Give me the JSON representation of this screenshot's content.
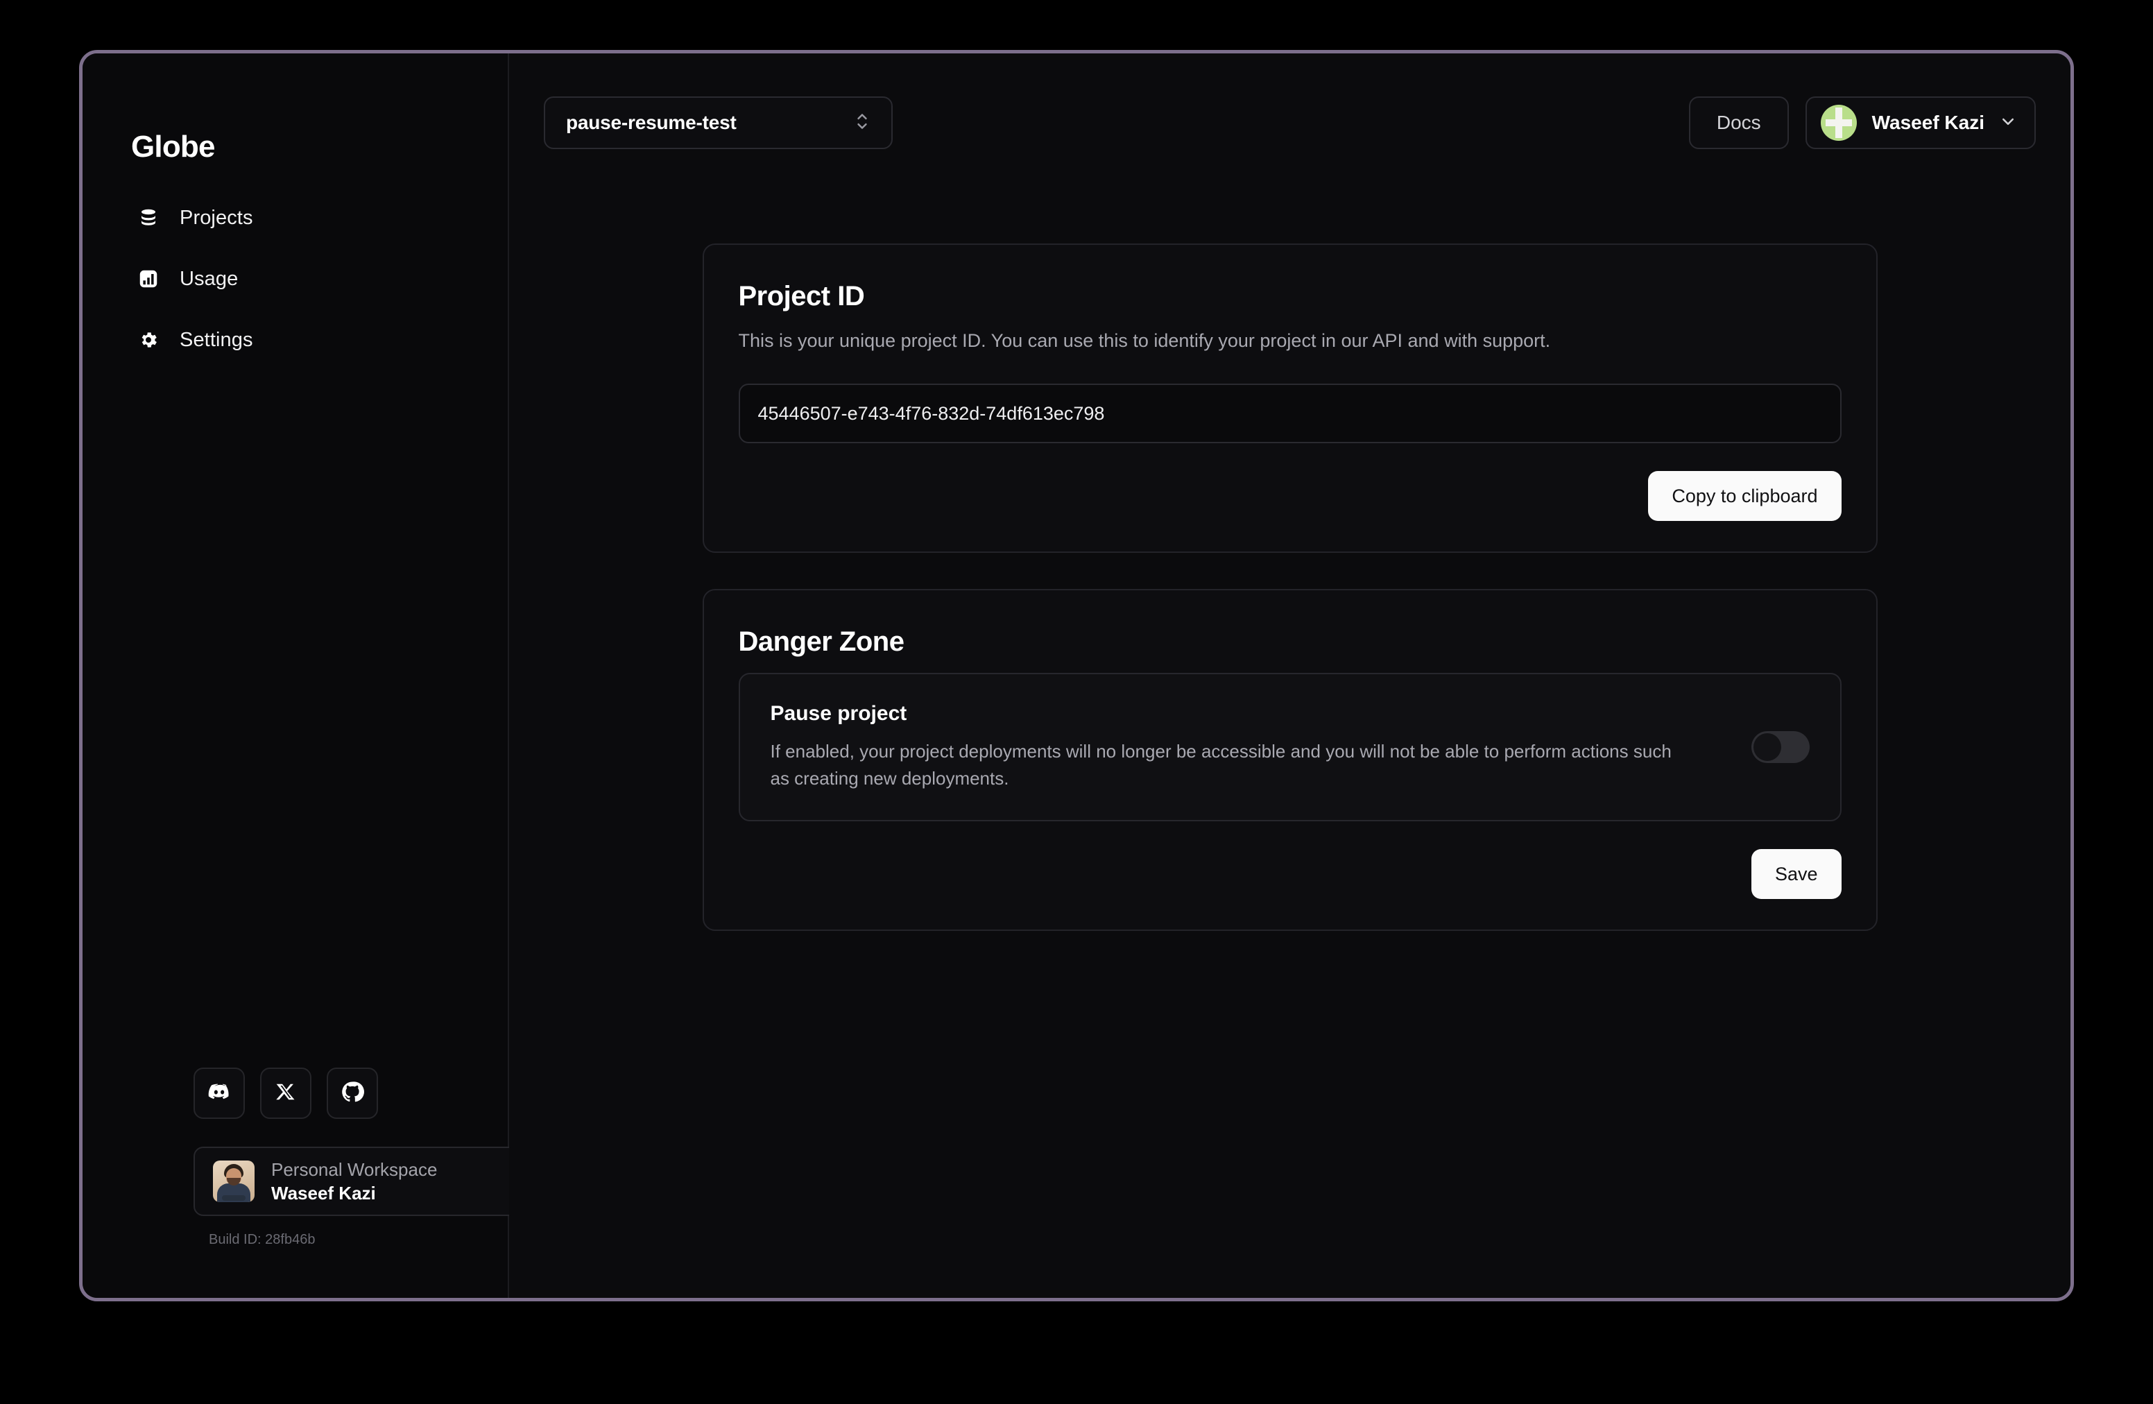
{
  "window": {
    "border_color": "#7d6f8c",
    "background": "#0b0b0d"
  },
  "sidebar": {
    "brand": "Globe",
    "items": [
      {
        "label": "Projects",
        "icon": "database-icon"
      },
      {
        "label": "Usage",
        "icon": "bar-chart-icon"
      },
      {
        "label": "Settings",
        "icon": "gear-icon"
      }
    ],
    "social": [
      {
        "name": "discord-icon"
      },
      {
        "name": "x-icon"
      },
      {
        "name": "github-icon"
      }
    ],
    "workspace": {
      "type": "Personal Workspace",
      "name": "Waseef Kazi"
    },
    "build_id": "Build ID: 28fb46b"
  },
  "topbar": {
    "project_selector": {
      "value": "pause-resume-test"
    },
    "docs_label": "Docs",
    "user": {
      "name": "Waseef Kazi",
      "avatar_color": "#b9de8a"
    }
  },
  "main": {
    "project_id_card": {
      "title": "Project ID",
      "description": "This is your unique project ID. You can use this to identify your project in our API and with support.",
      "value": "45446507-e743-4f76-832d-74df613ec798",
      "placeholder": "Project ID",
      "copy_label": "Copy to clipboard"
    },
    "danger_zone_card": {
      "title": "Danger Zone",
      "pause": {
        "heading": "Pause project",
        "description": "If enabled, your project deployments will no longer be accessible and you will not be able to perform actions such as creating new deployments.",
        "enabled": false
      },
      "save_label": "Save"
    }
  }
}
